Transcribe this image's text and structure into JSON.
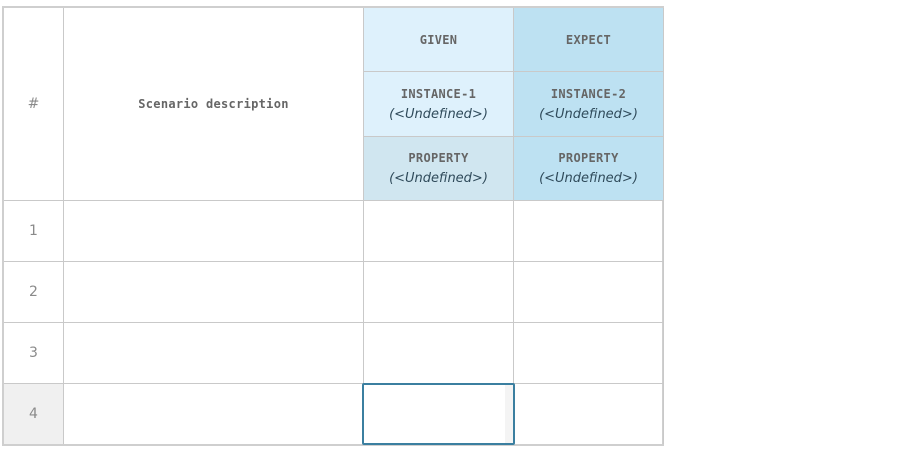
{
  "header": {
    "row_number_label": "#",
    "description_label": "Scenario description",
    "given_label": "GIVEN",
    "expect_label": "EXPECT",
    "instance1": {
      "name": "INSTANCE-1",
      "value": "(<Undefined>)"
    },
    "instance2": {
      "name": "INSTANCE-2",
      "value": "(<Undefined>)"
    },
    "property1": {
      "name": "PROPERTY",
      "value": "(<Undefined>)"
    },
    "property2": {
      "name": "PROPERTY",
      "value": "(<Undefined>)"
    }
  },
  "rows": [
    {
      "number": "1",
      "description": "",
      "given": "",
      "expect": ""
    },
    {
      "number": "2",
      "description": "",
      "given": "",
      "expect": ""
    },
    {
      "number": "3",
      "description": "",
      "given": "",
      "expect": ""
    },
    {
      "number": "4",
      "description": "",
      "given": "",
      "expect": ""
    }
  ],
  "selection": {
    "row": "4",
    "column": "GIVEN"
  },
  "colors": {
    "given_header": "#def1fc",
    "expect_header": "#bde1f2",
    "property_given": "#d0e6f0",
    "selection_border": "#3b7fa0",
    "selected_row_number_bg": "#f0f0f0"
  }
}
